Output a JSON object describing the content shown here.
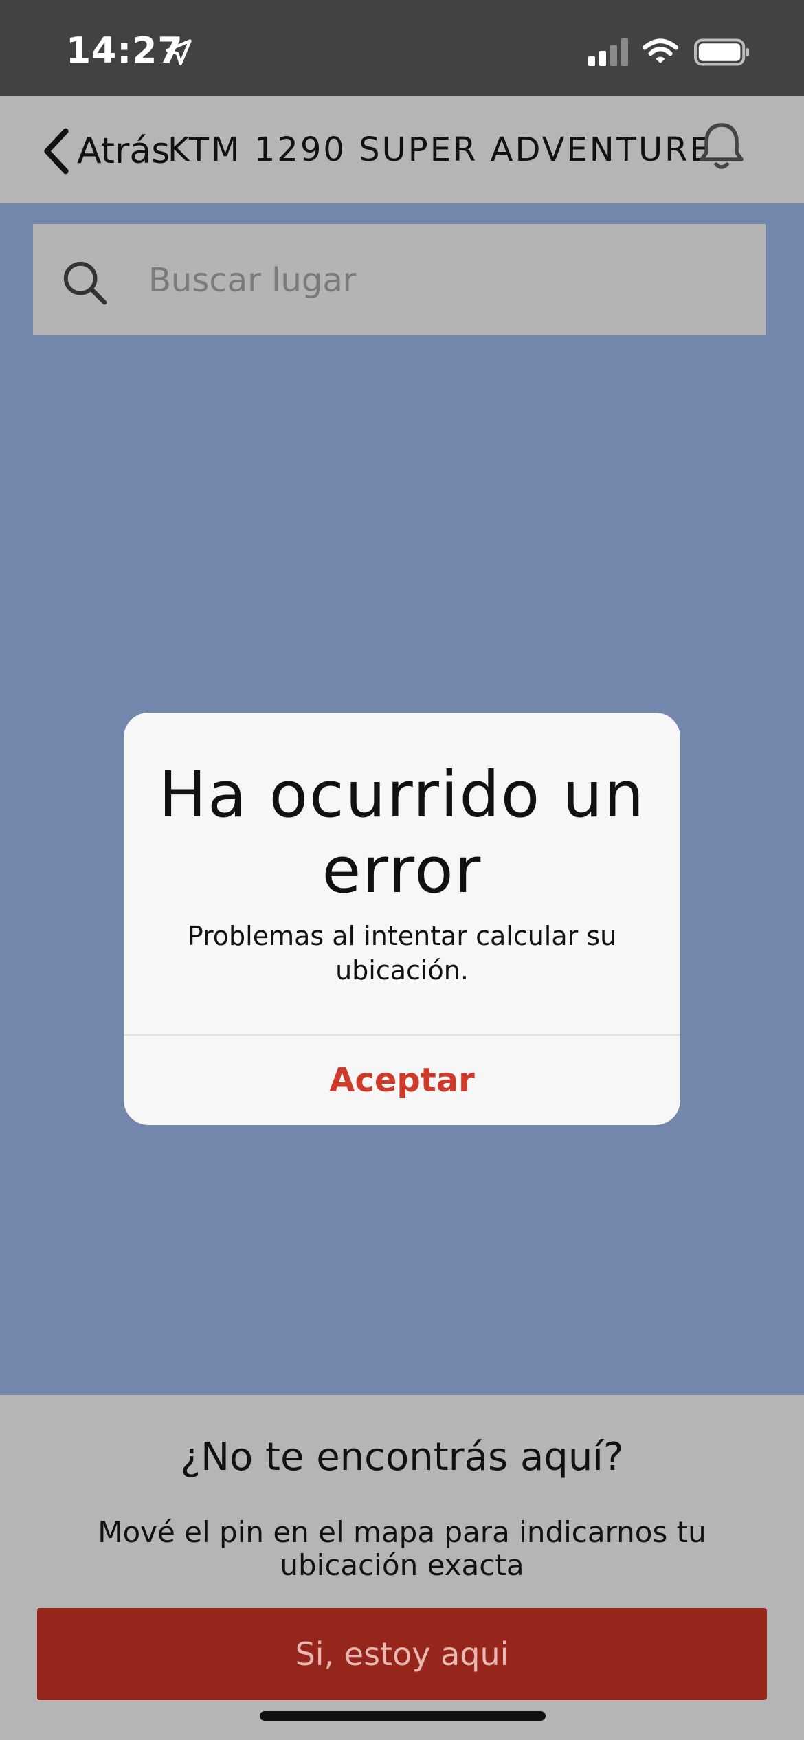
{
  "status_bar": {
    "time": "14:27",
    "icons": [
      "location-arrow-icon",
      "cellular-signal-icon",
      "wifi-icon",
      "battery-icon"
    ]
  },
  "nav": {
    "back_label": "Atrás",
    "title": "KTM 1290 SUPER ADVENTURE",
    "right_icon": "bell-icon"
  },
  "search": {
    "placeholder": "Buscar lugar",
    "icon": "search-icon"
  },
  "dialog": {
    "title": "Ha ocurrido un error",
    "message": "Problemas al intentar calcular su ubicación.",
    "accept_label": "Aceptar"
  },
  "bottom_panel": {
    "title": "¿No te encontrás aquí?",
    "description": "Mové el pin en el mapa para indicarnos tu ubicación exacta",
    "confirm_label": "Si, estoy aqui"
  },
  "colors": {
    "map_background": "#7387ad",
    "status_bar": "#424242",
    "panel_gray": "#b5b5b5",
    "accent_red": "#d03a2b",
    "button_red": "#96261b"
  }
}
